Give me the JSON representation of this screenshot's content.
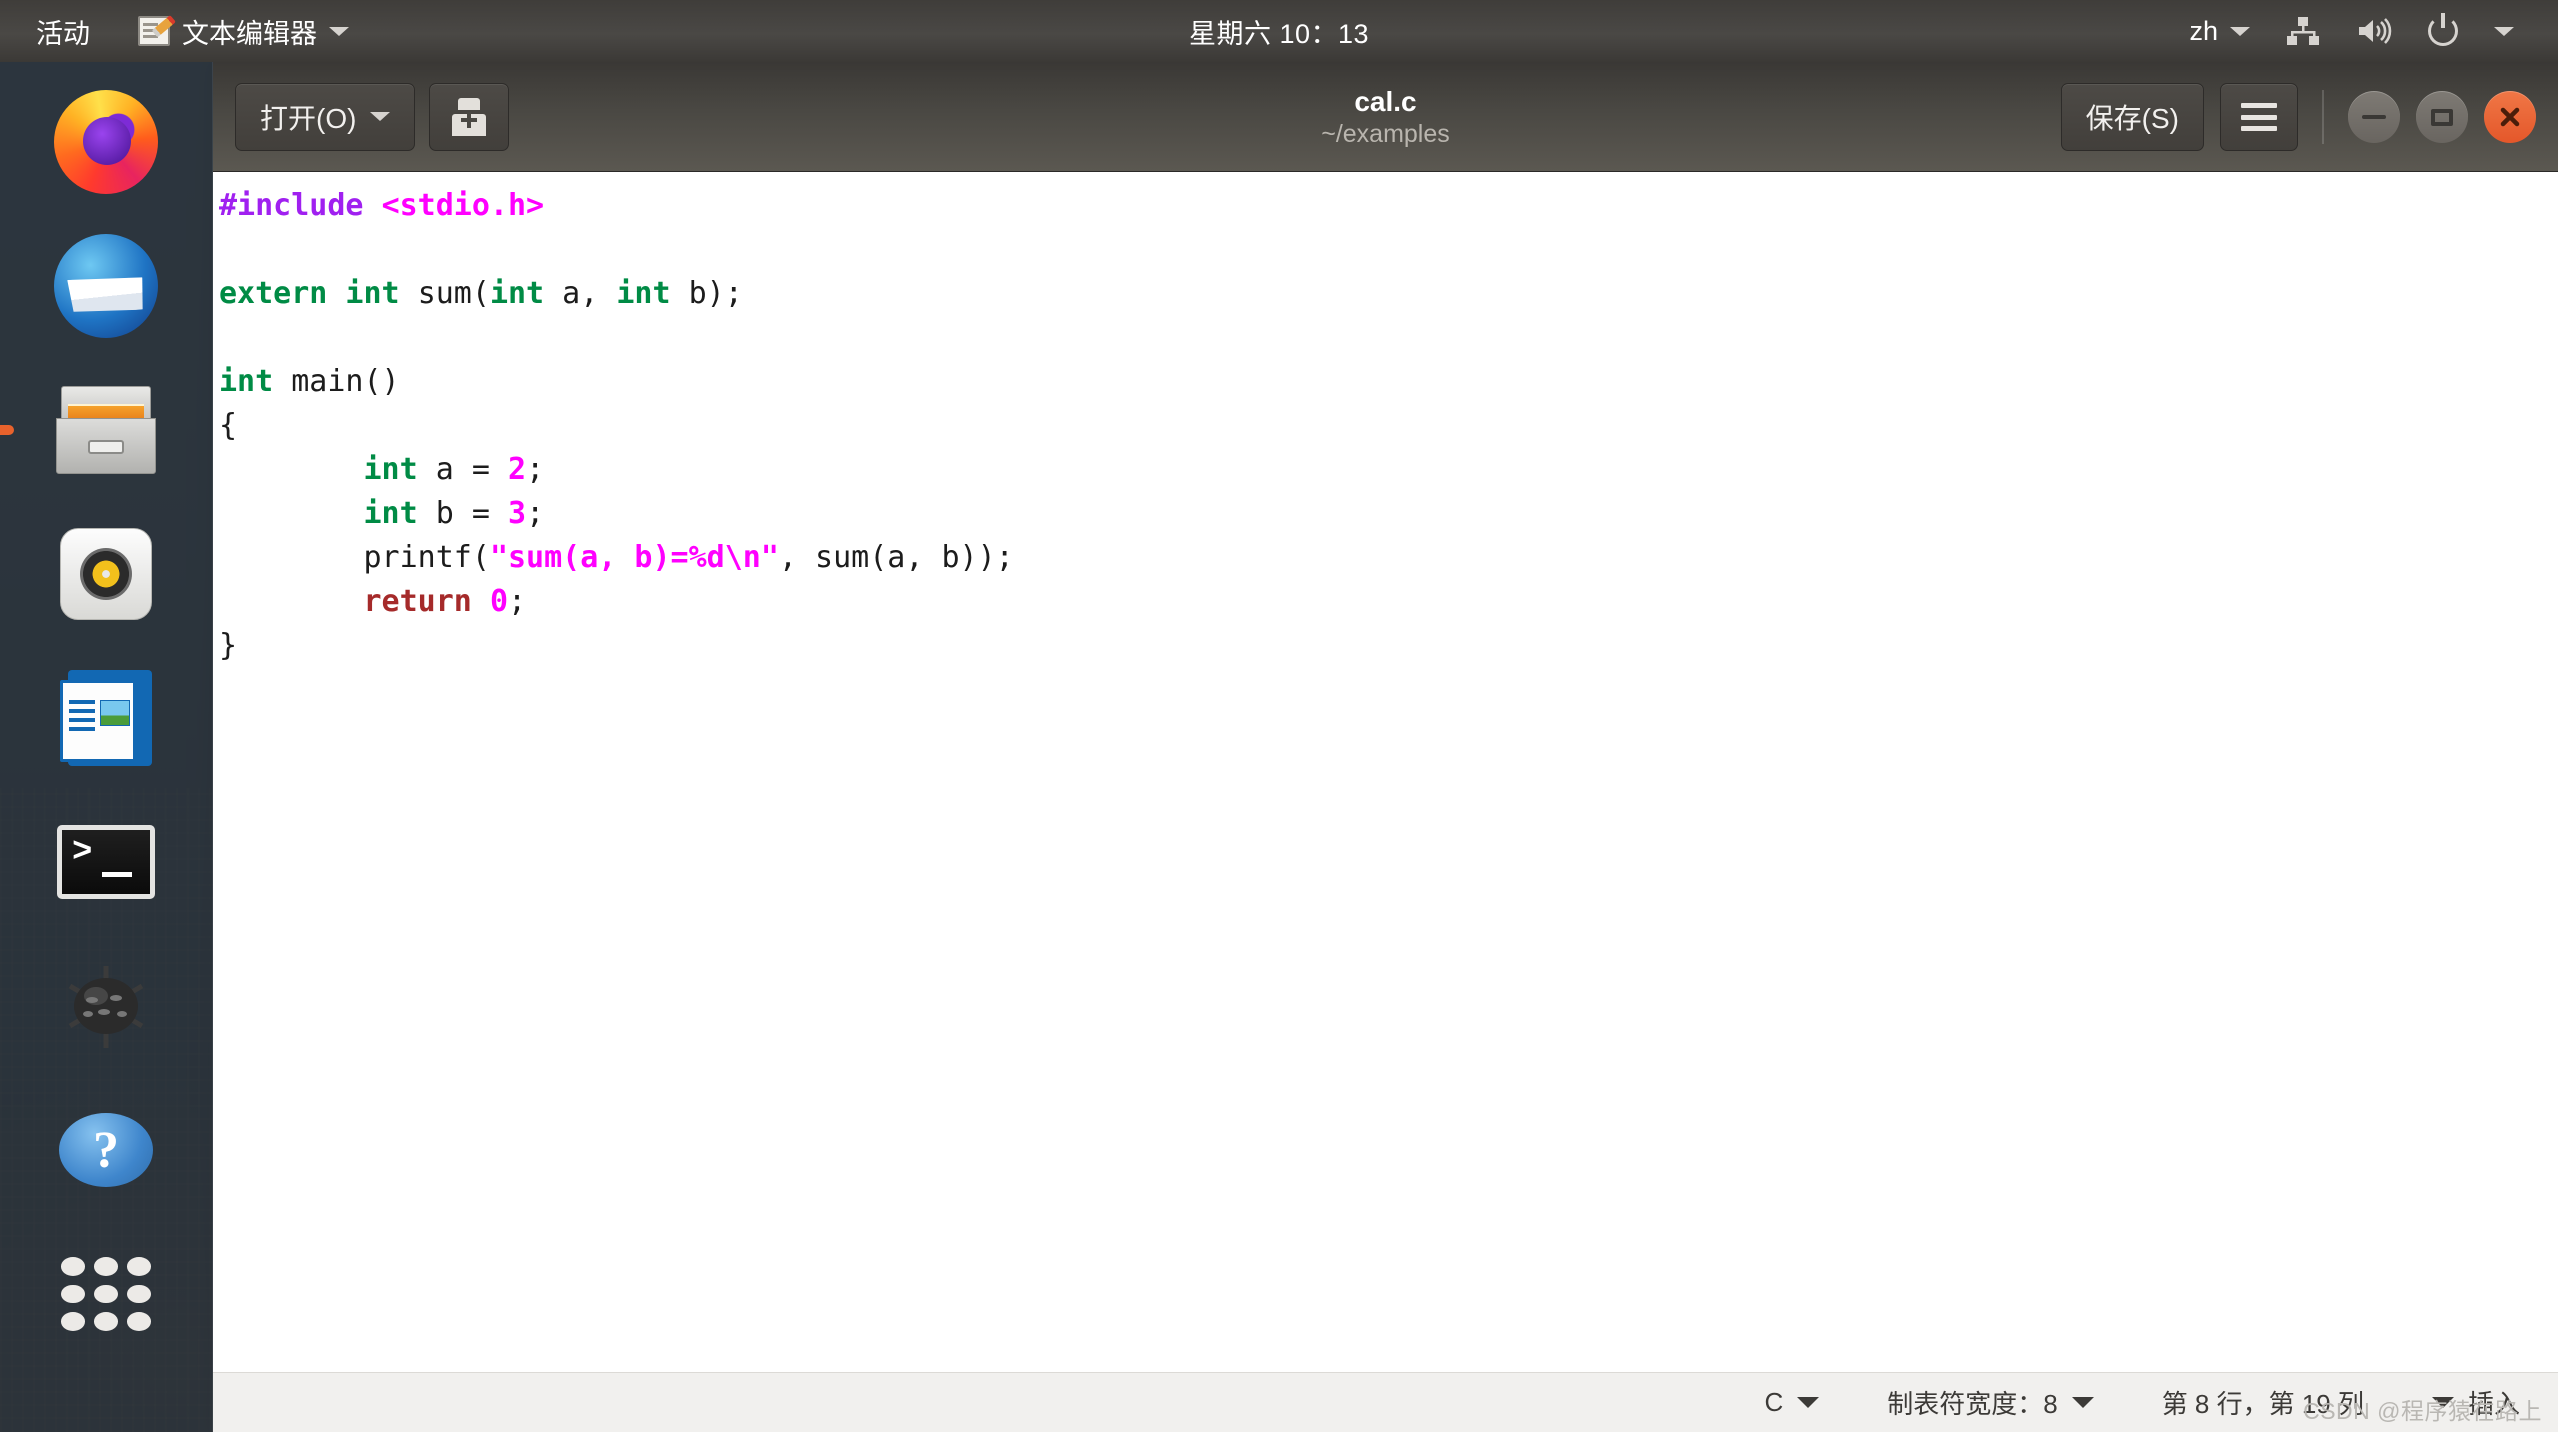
{
  "topbar": {
    "activities": "活动",
    "app_icon": "gedit-icon",
    "app_name": "文本编辑器",
    "app_menu_caret": "chevron-down-icon",
    "clock": "星期六 10：13",
    "keyboard_layout": "zh",
    "indicators": [
      "network-icon",
      "volume-icon",
      "power-icon",
      "chevron-down-icon"
    ]
  },
  "dock": {
    "items": [
      {
        "name": "firefox",
        "label": "Firefox",
        "running": false
      },
      {
        "name": "thunderbird",
        "label": "Thunderbird",
        "running": false
      },
      {
        "name": "files",
        "label": "Files",
        "running": true
      },
      {
        "name": "rhythmbox",
        "label": "Rhythmbox",
        "running": false
      },
      {
        "name": "libreoffice-writer",
        "label": "LibreOffice Writer",
        "running": false
      },
      {
        "name": "terminal",
        "label": "Terminal",
        "running": false
      },
      {
        "name": "mines",
        "label": "Mines",
        "running": false
      },
      {
        "name": "help",
        "label": "Help",
        "running": false
      },
      {
        "name": "show-applications",
        "label": "Show Applications",
        "running": false
      }
    ]
  },
  "window": {
    "header": {
      "open_button": "打开(O)",
      "open_caret": "chevron-down-icon",
      "new_doc_icon": "new-document-icon",
      "title": "cal.c",
      "subtitle": "~/examples",
      "save_button": "保存(S)",
      "menu_icon": "hamburger-menu-icon",
      "minimize": "−",
      "maximize": "□",
      "close": "✕"
    },
    "editor": {
      "lines": [
        [
          {
            "t": "#include ",
            "c": "k-pp"
          },
          {
            "t": "<stdio.h>",
            "c": "k-inc"
          }
        ],
        [
          {
            "t": "",
            "c": "k-plain"
          }
        ],
        [
          {
            "t": "extern int ",
            "c": "k-type"
          },
          {
            "t": "sum(",
            "c": "k-plain"
          },
          {
            "t": "int",
            "c": "k-type"
          },
          {
            "t": " a, ",
            "c": "k-plain"
          },
          {
            "t": "int",
            "c": "k-type"
          },
          {
            "t": " b);",
            "c": "k-plain"
          }
        ],
        [
          {
            "t": "",
            "c": "k-plain"
          }
        ],
        [
          {
            "t": "int",
            "c": "k-type"
          },
          {
            "t": " main()",
            "c": "k-plain"
          }
        ],
        [
          {
            "t": "{",
            "c": "k-plain"
          }
        ],
        [
          {
            "t": "        ",
            "c": "k-plain"
          },
          {
            "t": "int",
            "c": "k-type"
          },
          {
            "t": " a = ",
            "c": "k-plain"
          },
          {
            "t": "2",
            "c": "k-num"
          },
          {
            "t": ";",
            "c": "k-plain"
          }
        ],
        [
          {
            "t": "        ",
            "c": "k-plain"
          },
          {
            "t": "int",
            "c": "k-type"
          },
          {
            "t": " b = ",
            "c": "k-plain"
          },
          {
            "t": "3",
            "c": "k-num"
          },
          {
            "t": ";",
            "c": "k-plain"
          }
        ],
        [
          {
            "t": "        printf(",
            "c": "k-plain"
          },
          {
            "t": "\"sum(a, b)=%d\\n\"",
            "c": "k-str"
          },
          {
            "t": ", sum(a, b));",
            "c": "k-plain"
          }
        ],
        [
          {
            "t": "        ",
            "c": "k-plain"
          },
          {
            "t": "return",
            "c": "k-ret"
          },
          {
            "t": " ",
            "c": "k-plain"
          },
          {
            "t": "0",
            "c": "k-num"
          },
          {
            "t": ";",
            "c": "k-plain"
          }
        ],
        [
          {
            "t": "}",
            "c": "k-plain"
          }
        ]
      ]
    },
    "statusbar": {
      "language": "C",
      "tab_width": "制表符宽度：8",
      "position": "第 8 行，第 19 列",
      "insert_mode": "插入"
    }
  },
  "watermark": "CSDN @程序猿在路上",
  "colors": {
    "topbar_bg": "#4a4845",
    "headerbar_bg": "#4a4843",
    "editor_bg": "#ffffff",
    "statusbar_bg": "#f1f0ee",
    "close_button": "#e4572a",
    "dock_bg": "#2c343c",
    "accent_preproc": "#a020f0",
    "accent_include": "#ff00ff",
    "accent_type": "#008b45",
    "accent_string": "#ff00ff",
    "accent_return": "#a52a2a"
  }
}
